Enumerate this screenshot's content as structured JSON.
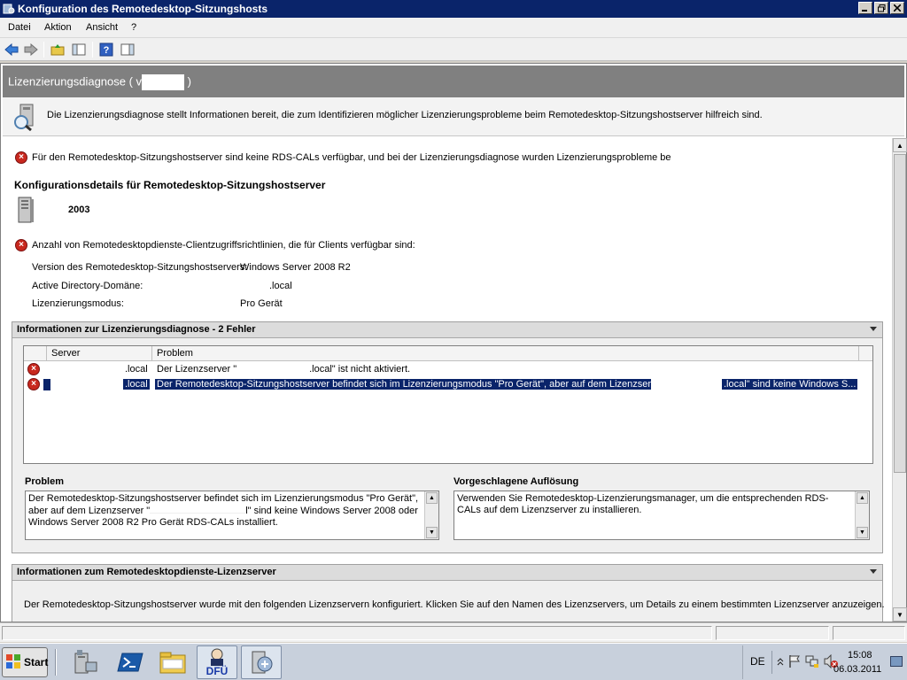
{
  "window": {
    "title": "Konfiguration des Remotedesktop-Sitzungshosts"
  },
  "menu": [
    "Datei",
    "Aktion",
    "Ansicht",
    "?"
  ],
  "header": {
    "title_prefix": "Lizenzierungsdiagnose ( v",
    "title_suffix": ")",
    "description": "Die Lizenzierungsdiagnose stellt Informationen bereit, die zum Identifizieren möglicher Lizenzierungsprobleme beim Remotedesktop-Sitzungshostserver hilfreich sind."
  },
  "content": {
    "warning": "Für den Remotedesktop-Sitzungshostserver sind keine RDS-CALs verfügbar, und bei der Lizenzierungsdiagnose wurden Lizenzierungsprobleme be",
    "config_heading": "Konfigurationsdetails für Remotedesktop-Sitzungshostserver",
    "server_name": "2003",
    "cal_count_label": "Anzahl von Remotedesktopdienste-Clientzugriffsrichtlinien, die für Clients verfügbar sind:",
    "details": [
      {
        "label": "Version des Remotedesktop-Sitzungshostservers:",
        "value": "Windows Server 2008 R2"
      },
      {
        "label": "Active Directory-Domäne:",
        "value": ".local"
      },
      {
        "label": "Lizenzierungsmodus:",
        "value": "Pro Gerät"
      }
    ]
  },
  "diagnose_section": {
    "title": "Informationen zur Lizenzierungsdiagnose - 2 Fehler",
    "columns": [
      "Server",
      "Problem"
    ],
    "rows": [
      {
        "server": ".local",
        "problem_prefix": "Der Lizenzserver \"",
        "problem_suffix": ".local\" ist nicht aktiviert."
      },
      {
        "server": ".local",
        "problem_prefix": "Der Remotedesktop-Sitzungshostserver befindet sich im Lizenzierungsmodus \"Pro Gerät\", aber auf dem Lizenzserver \"",
        "problem_suffix": ".local\" sind keine Windows S..."
      }
    ],
    "problem_label": "Problem",
    "problem_text_1": "Der Remotedesktop-Sitzungshostserver befindet sich im Lizenzierungsmodus \"Pro Gerät\", aber auf dem Lizenzserver \"",
    "problem_text_2": "l\" sind keine Windows Server 2008 oder Windows Server 2008 R2 Pro Gerät RDS-CALs installiert.",
    "resolution_label": "Vorgeschlagene Auflösung",
    "resolution_text": "Verwenden Sie Remotedesktop-Lizenzierungsmanager, um die entsprechenden RDS-CALs auf dem Lizenzserver zu installieren."
  },
  "license_section": {
    "title": "Informationen zum Remotedesktopdienste-Lizenzserver",
    "text": "Der Remotedesktop-Sitzungshostserver wurde mit den folgenden Lizenzservern konfiguriert. Klicken Sie auf den Namen des Lizenzservers, um Details zu einem bestimmten Lizenzserver anzuzeigen."
  },
  "taskbar": {
    "start": "Start",
    "language": "DE",
    "time": "15:08",
    "date": "06.03.2011",
    "dfu_label": "DFÜ"
  },
  "colors": {
    "title_bar": "#0a246a",
    "header_bar": "#808080",
    "error_red": "#c8281e",
    "selection": "#0a246a"
  }
}
